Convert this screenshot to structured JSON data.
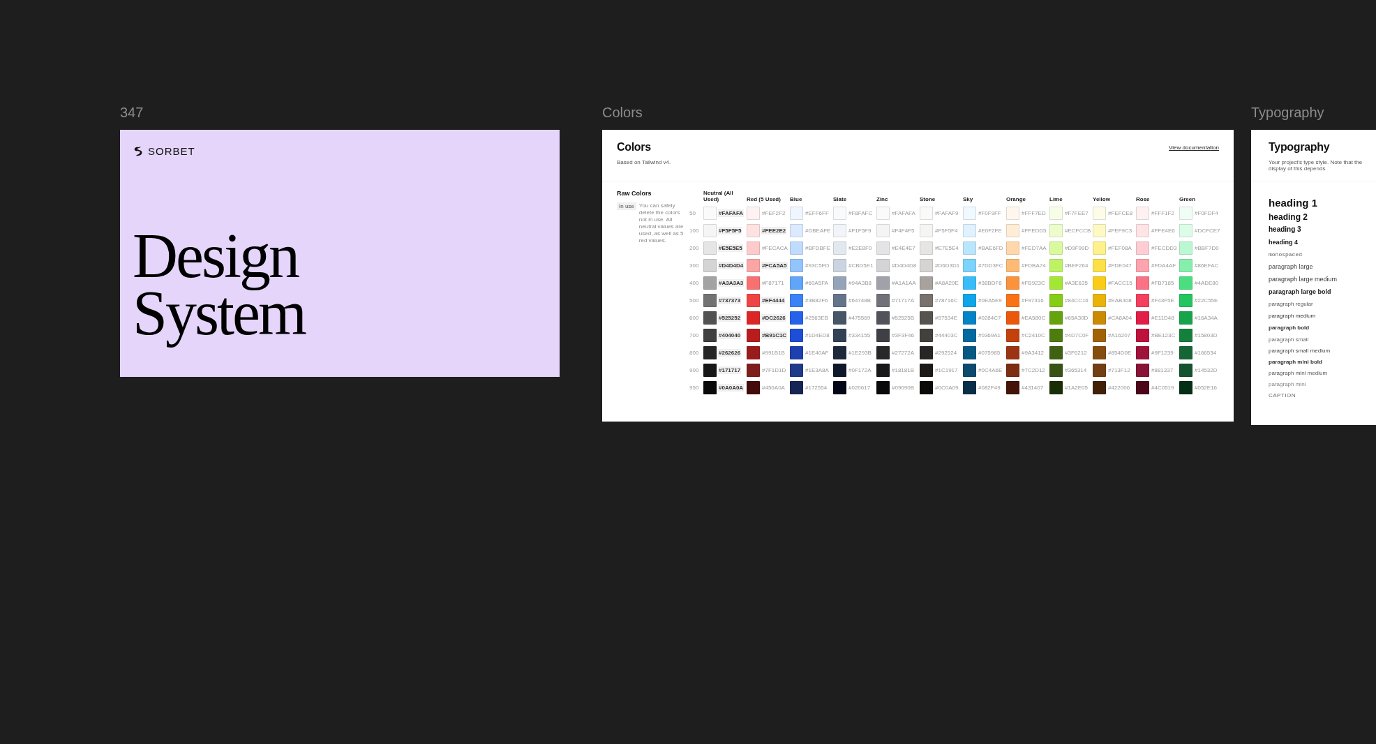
{
  "cover": {
    "frame_label": "347",
    "brand": "SORBET",
    "title_lines": [
      "Design",
      "System"
    ]
  },
  "colors": {
    "frame_label": "Colors",
    "title": "Colors",
    "subtitle": "Based on Tailwind v4.",
    "link": "View documentation",
    "section_title": "Raw Colors",
    "badge": "In use",
    "note": "You can safely delete the colors not in use. All neutral values are used, as well as 5 red values.",
    "steps": [
      "50",
      "100",
      "200",
      "300",
      "400",
      "500",
      "600",
      "700",
      "800",
      "900",
      "950"
    ],
    "columns": [
      {
        "name": "Neutral (All Used)",
        "swatches": [
          {
            "hex": "#FAFAFA",
            "color": "#fafafa",
            "used": true
          },
          {
            "hex": "#F5F5F5",
            "color": "#f5f5f5",
            "used": true
          },
          {
            "hex": "#E5E5E5",
            "color": "#e5e5e5",
            "used": true
          },
          {
            "hex": "#D4D4D4",
            "color": "#d4d4d4",
            "used": true
          },
          {
            "hex": "#A3A3A3",
            "color": "#a3a3a3",
            "used": true
          },
          {
            "hex": "#737373",
            "color": "#737373",
            "used": true
          },
          {
            "hex": "#525252",
            "color": "#525252",
            "used": true
          },
          {
            "hex": "#404040",
            "color": "#404040",
            "used": true
          },
          {
            "hex": "#262626",
            "color": "#262626",
            "used": true
          },
          {
            "hex": "#171717",
            "color": "#171717",
            "used": true
          },
          {
            "hex": "#0A0A0A",
            "color": "#0a0a0a",
            "used": true
          }
        ]
      },
      {
        "name": "Red (5 Used)",
        "swatches": [
          {
            "hex": "#FEF2F2",
            "color": "#fef2f2",
            "used": false
          },
          {
            "hex": "#FEE2E2",
            "color": "#fee2e2",
            "used": true
          },
          {
            "hex": "#FECACA",
            "color": "#fecaca",
            "used": false
          },
          {
            "hex": "#FCA5A5",
            "color": "#fca5a5",
            "used": true
          },
          {
            "hex": "#F87171",
            "color": "#f87171",
            "used": false
          },
          {
            "hex": "#EF4444",
            "color": "#ef4444",
            "used": true
          },
          {
            "hex": "#DC2626",
            "color": "#dc2626",
            "used": true
          },
          {
            "hex": "#B91C1C",
            "color": "#b91c1c",
            "used": true
          },
          {
            "hex": "#991B1B",
            "color": "#991b1b",
            "used": false
          },
          {
            "hex": "#7F1D1D",
            "color": "#7f1d1d",
            "used": false
          },
          {
            "hex": "#450A0A",
            "color": "#450a0a",
            "used": false
          }
        ]
      },
      {
        "name": "Blue",
        "swatches": [
          {
            "hex": "#EFF6FF",
            "color": "#eff6ff",
            "used": false
          },
          {
            "hex": "#DBEAFE",
            "color": "#dbeafe",
            "used": false
          },
          {
            "hex": "#BFDBFE",
            "color": "#bfdbfe",
            "used": false
          },
          {
            "hex": "#93C5FD",
            "color": "#93c5fd",
            "used": false
          },
          {
            "hex": "#60A5FA",
            "color": "#60a5fa",
            "used": false
          },
          {
            "hex": "#3B82F6",
            "color": "#3b82f6",
            "used": false
          },
          {
            "hex": "#2563EB",
            "color": "#2563eb",
            "used": false
          },
          {
            "hex": "#1D4ED8",
            "color": "#1d4ed8",
            "used": false
          },
          {
            "hex": "#1E40AF",
            "color": "#1e40af",
            "used": false
          },
          {
            "hex": "#1E3A8A",
            "color": "#1e3a8a",
            "used": false
          },
          {
            "hex": "#172554",
            "color": "#172554",
            "used": false
          }
        ]
      },
      {
        "name": "Slate",
        "swatches": [
          {
            "hex": "#F8FAFC",
            "color": "#f8fafc",
            "used": false
          },
          {
            "hex": "#F1F5F9",
            "color": "#f1f5f9",
            "used": false
          },
          {
            "hex": "#E2E8F0",
            "color": "#e2e8f0",
            "used": false
          },
          {
            "hex": "#CBD5E1",
            "color": "#cbd5e1",
            "used": false
          },
          {
            "hex": "#94A3B8",
            "color": "#94a3b8",
            "used": false
          },
          {
            "hex": "#64748B",
            "color": "#64748b",
            "used": false
          },
          {
            "hex": "#475569",
            "color": "#475569",
            "used": false
          },
          {
            "hex": "#334155",
            "color": "#334155",
            "used": false
          },
          {
            "hex": "#1E293B",
            "color": "#1e293b",
            "used": false
          },
          {
            "hex": "#0F172A",
            "color": "#0f172a",
            "used": false
          },
          {
            "hex": "#020617",
            "color": "#020617",
            "used": false
          }
        ]
      },
      {
        "name": "Zinc",
        "swatches": [
          {
            "hex": "#FAFAFA",
            "color": "#fafafa",
            "used": false
          },
          {
            "hex": "#F4F4F5",
            "color": "#f4f4f5",
            "used": false
          },
          {
            "hex": "#E4E4E7",
            "color": "#e4e4e7",
            "used": false
          },
          {
            "hex": "#D4D4D8",
            "color": "#d4d4d8",
            "used": false
          },
          {
            "hex": "#A1A1AA",
            "color": "#a1a1aa",
            "used": false
          },
          {
            "hex": "#71717A",
            "color": "#71717a",
            "used": false
          },
          {
            "hex": "#52525B",
            "color": "#52525b",
            "used": false
          },
          {
            "hex": "#3F3F46",
            "color": "#3f3f46",
            "used": false
          },
          {
            "hex": "#27272A",
            "color": "#27272a",
            "used": false
          },
          {
            "hex": "#18181B",
            "color": "#18181b",
            "used": false
          },
          {
            "hex": "#09090B",
            "color": "#09090b",
            "used": false
          }
        ]
      },
      {
        "name": "Stone",
        "swatches": [
          {
            "hex": "#FAFAF9",
            "color": "#fafaf9",
            "used": false
          },
          {
            "hex": "#F5F5F4",
            "color": "#f5f5f4",
            "used": false
          },
          {
            "hex": "#E7E5E4",
            "color": "#e7e5e4",
            "used": false
          },
          {
            "hex": "#D6D3D1",
            "color": "#d6d3d1",
            "used": false
          },
          {
            "hex": "#A8A29E",
            "color": "#a8a29e",
            "used": false
          },
          {
            "hex": "#78716C",
            "color": "#78716c",
            "used": false
          },
          {
            "hex": "#57534E",
            "color": "#57534e",
            "used": false
          },
          {
            "hex": "#44403C",
            "color": "#44403c",
            "used": false
          },
          {
            "hex": "#292524",
            "color": "#292524",
            "used": false
          },
          {
            "hex": "#1C1917",
            "color": "#1c1917",
            "used": false
          },
          {
            "hex": "#0C0A09",
            "color": "#0c0a09",
            "used": false
          }
        ]
      },
      {
        "name": "Sky",
        "swatches": [
          {
            "hex": "#F0F9FF",
            "color": "#f0f9ff",
            "used": false
          },
          {
            "hex": "#E0F2FE",
            "color": "#e0f2fe",
            "used": false
          },
          {
            "hex": "#BAE6FD",
            "color": "#bae6fd",
            "used": false
          },
          {
            "hex": "#7DD3FC",
            "color": "#7dd3fc",
            "used": false
          },
          {
            "hex": "#38BDF8",
            "color": "#38bdf8",
            "used": false
          },
          {
            "hex": "#0EA5E9",
            "color": "#0ea5e9",
            "used": false
          },
          {
            "hex": "#0284C7",
            "color": "#0284c7",
            "used": false
          },
          {
            "hex": "#0369A1",
            "color": "#0369a1",
            "used": false
          },
          {
            "hex": "#075985",
            "color": "#075985",
            "used": false
          },
          {
            "hex": "#0C4A6E",
            "color": "#0c4a6e",
            "used": false
          },
          {
            "hex": "#082F49",
            "color": "#082f49",
            "used": false
          }
        ]
      },
      {
        "name": "Orange",
        "swatches": [
          {
            "hex": "#FFF7ED",
            "color": "#fff7ed",
            "used": false
          },
          {
            "hex": "#FFEDD5",
            "color": "#ffedd5",
            "used": false
          },
          {
            "hex": "#FED7AA",
            "color": "#fed7aa",
            "used": false
          },
          {
            "hex": "#FDBA74",
            "color": "#fdba74",
            "used": false
          },
          {
            "hex": "#FB923C",
            "color": "#fb923c",
            "used": false
          },
          {
            "hex": "#F97316",
            "color": "#f97316",
            "used": false
          },
          {
            "hex": "#EA580C",
            "color": "#ea580c",
            "used": false
          },
          {
            "hex": "#C2410C",
            "color": "#c2410c",
            "used": false
          },
          {
            "hex": "#9A3412",
            "color": "#9a3412",
            "used": false
          },
          {
            "hex": "#7C2D12",
            "color": "#7c2d12",
            "used": false
          },
          {
            "hex": "#431407",
            "color": "#431407",
            "used": false
          }
        ]
      },
      {
        "name": "Lime",
        "swatches": [
          {
            "hex": "#F7FEE7",
            "color": "#f7fee7",
            "used": false
          },
          {
            "hex": "#ECFCCB",
            "color": "#ecfccb",
            "used": false
          },
          {
            "hex": "#D9F99D",
            "color": "#d9f99d",
            "used": false
          },
          {
            "hex": "#BEF264",
            "color": "#bef264",
            "used": false
          },
          {
            "hex": "#A3E635",
            "color": "#a3e635",
            "used": false
          },
          {
            "hex": "#84CC16",
            "color": "#84cc16",
            "used": false
          },
          {
            "hex": "#65A30D",
            "color": "#65a30d",
            "used": false
          },
          {
            "hex": "#4D7C0F",
            "color": "#4d7c0f",
            "used": false
          },
          {
            "hex": "#3F6212",
            "color": "#3f6212",
            "used": false
          },
          {
            "hex": "#365314",
            "color": "#365314",
            "used": false
          },
          {
            "hex": "#1A2E05",
            "color": "#1a2e05",
            "used": false
          }
        ]
      },
      {
        "name": "Yellow",
        "swatches": [
          {
            "hex": "#FEFCE8",
            "color": "#fefce8",
            "used": false
          },
          {
            "hex": "#FEF9C3",
            "color": "#fef9c3",
            "used": false
          },
          {
            "hex": "#FEF08A",
            "color": "#fef08a",
            "used": false
          },
          {
            "hex": "#FDE047",
            "color": "#fde047",
            "used": false
          },
          {
            "hex": "#FACC15",
            "color": "#facc15",
            "used": false
          },
          {
            "hex": "#EAB308",
            "color": "#eab308",
            "used": false
          },
          {
            "hex": "#CA8A04",
            "color": "#ca8a04",
            "used": false
          },
          {
            "hex": "#A16207",
            "color": "#a16207",
            "used": false
          },
          {
            "hex": "#854D0E",
            "color": "#854d0e",
            "used": false
          },
          {
            "hex": "#713F12",
            "color": "#713f12",
            "used": false
          },
          {
            "hex": "#422006",
            "color": "#422006",
            "used": false
          }
        ]
      },
      {
        "name": "Rose",
        "swatches": [
          {
            "hex": "#FFF1F2",
            "color": "#fff1f2",
            "used": false
          },
          {
            "hex": "#FFE4E6",
            "color": "#ffe4e6",
            "used": false
          },
          {
            "hex": "#FECDD3",
            "color": "#fecdd3",
            "used": false
          },
          {
            "hex": "#FDA4AF",
            "color": "#fda4af",
            "used": false
          },
          {
            "hex": "#FB7185",
            "color": "#fb7185",
            "used": false
          },
          {
            "hex": "#F43F5E",
            "color": "#f43f5e",
            "used": false
          },
          {
            "hex": "#E11D48",
            "color": "#e11d48",
            "used": false
          },
          {
            "hex": "#BE123C",
            "color": "#be123c",
            "used": false
          },
          {
            "hex": "#9F1239",
            "color": "#9f1239",
            "used": false
          },
          {
            "hex": "#881337",
            "color": "#881337",
            "used": false
          },
          {
            "hex": "#4C0519",
            "color": "#4c0519",
            "used": false
          }
        ]
      },
      {
        "name": "Green",
        "swatches": [
          {
            "hex": "#F0FDF4",
            "color": "#f0fdf4",
            "used": false
          },
          {
            "hex": "#DCFCE7",
            "color": "#dcfce7",
            "used": false
          },
          {
            "hex": "#BBF7D0",
            "color": "#bbf7d0",
            "used": false
          },
          {
            "hex": "#86EFAC",
            "color": "#86efac",
            "used": false
          },
          {
            "hex": "#4ADE80",
            "color": "#4ade80",
            "used": false
          },
          {
            "hex": "#22C55E",
            "color": "#22c55e",
            "used": false
          },
          {
            "hex": "#16A34A",
            "color": "#16a34a",
            "used": false
          },
          {
            "hex": "#15803D",
            "color": "#15803d",
            "used": false
          },
          {
            "hex": "#166534",
            "color": "#166534",
            "used": false
          },
          {
            "hex": "#14532D",
            "color": "#14532d",
            "used": false
          },
          {
            "hex": "#052E16",
            "color": "#052e16",
            "used": false
          }
        ]
      }
    ]
  },
  "typography": {
    "frame_label": "Typography",
    "title": "Typography",
    "subtitle": "Your project's type style. Note that the display of this depends",
    "styles": [
      {
        "kind": "h1",
        "label": "heading 1"
      },
      {
        "kind": "h2",
        "label": "heading 2"
      },
      {
        "kind": "h3",
        "label": "heading 3"
      },
      {
        "kind": "h4",
        "label": "heading 4"
      },
      {
        "kind": "mono",
        "label": "monospaced"
      },
      {
        "kind": "pl",
        "label": "paragraph large"
      },
      {
        "kind": "plm",
        "label": "paragraph large medium"
      },
      {
        "kind": "plb",
        "label": "paragraph large bold"
      },
      {
        "kind": "pr",
        "label": "paragraph regular"
      },
      {
        "kind": "pm",
        "label": "paragraph medium"
      },
      {
        "kind": "pb",
        "label": "paragraph bold"
      },
      {
        "kind": "ps",
        "label": "paragraph small"
      },
      {
        "kind": "psm",
        "label": "paragraph small medium"
      },
      {
        "kind": "pmb",
        "label": "paragraph mini bold"
      },
      {
        "kind": "pmm",
        "label": "paragraph mini medium"
      },
      {
        "kind": "pmini",
        "label": "paragraph mini"
      },
      {
        "kind": "caption",
        "label": "CAPTION"
      }
    ]
  }
}
